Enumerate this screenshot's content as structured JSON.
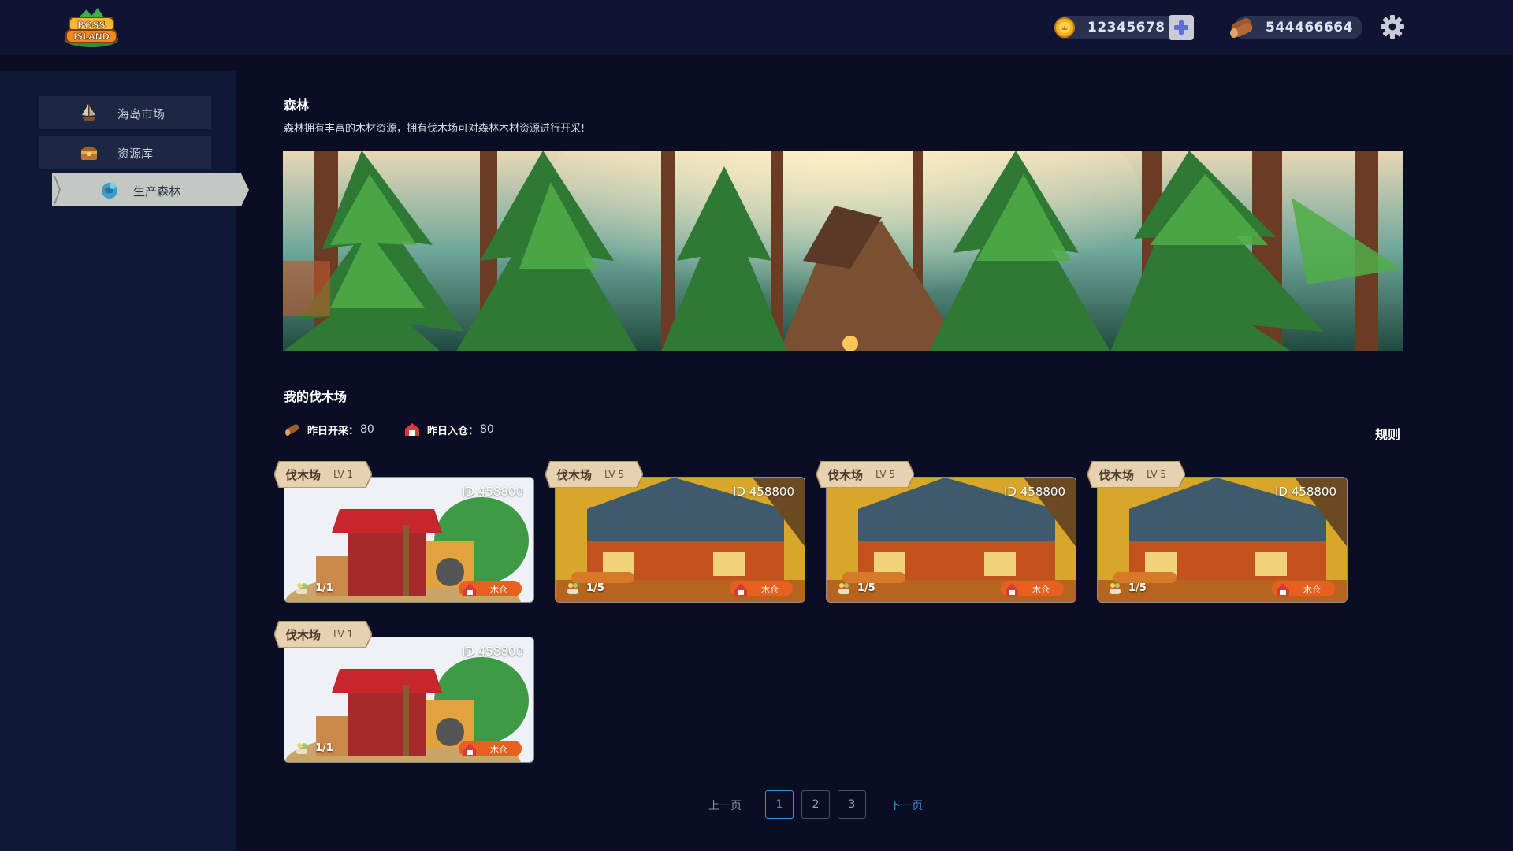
{
  "header": {
    "logo_text": [
      "BOSS",
      "ISLAND"
    ],
    "coins": "12345678",
    "wood": "544466664"
  },
  "sidebar": {
    "items": [
      {
        "label": "海岛市场",
        "icon": "ship-icon"
      },
      {
        "label": "资源库",
        "icon": "treasure-chest-icon"
      },
      {
        "label": "生产森林",
        "icon": "forest-globe-icon",
        "active": true
      }
    ]
  },
  "forest": {
    "title": "森林",
    "description": "森林拥有丰富的木材资源，拥有伐木场可对森林木材资源进行开采!"
  },
  "lumberyards": {
    "title": "我的伐木场",
    "yesterday_mined_label": "昨日开采：",
    "yesterday_mined_value": "80",
    "yesterday_stored_label": "昨日入仓：",
    "yesterday_stored_value": "80",
    "rules_label": "规则",
    "cards": [
      {
        "name": "伐木场",
        "level": "LV 1",
        "id": "ID 458800",
        "occupancy": "1/1",
        "warehouse": "木仓",
        "style": "red"
      },
      {
        "name": "伐木场",
        "level": "LV 5",
        "id": "ID 458800",
        "occupancy": "1/5",
        "warehouse": "木仓",
        "style": "orange"
      },
      {
        "name": "伐木场",
        "level": "LV 5",
        "id": "ID 458800",
        "occupancy": "1/5",
        "warehouse": "木仓",
        "style": "orange"
      },
      {
        "name": "伐木场",
        "level": "LV 5",
        "id": "ID 458800",
        "occupancy": "1/5",
        "warehouse": "木仓",
        "style": "orange"
      },
      {
        "name": "伐木场",
        "level": "LV 1",
        "id": "ID 458800",
        "occupancy": "1/1",
        "warehouse": "木仓",
        "style": "red"
      }
    ]
  },
  "pagination": {
    "prev_label": "上一页",
    "next_label": "下一页",
    "pages": [
      "1",
      "2",
      "3"
    ],
    "current": "1"
  },
  "colors": {
    "background": "#0b0d24",
    "topbar": "#0e1431",
    "sidebar": "#0f1836",
    "accent_blue": "#3f8fe0",
    "tag_beige": "#e6d2b0"
  }
}
